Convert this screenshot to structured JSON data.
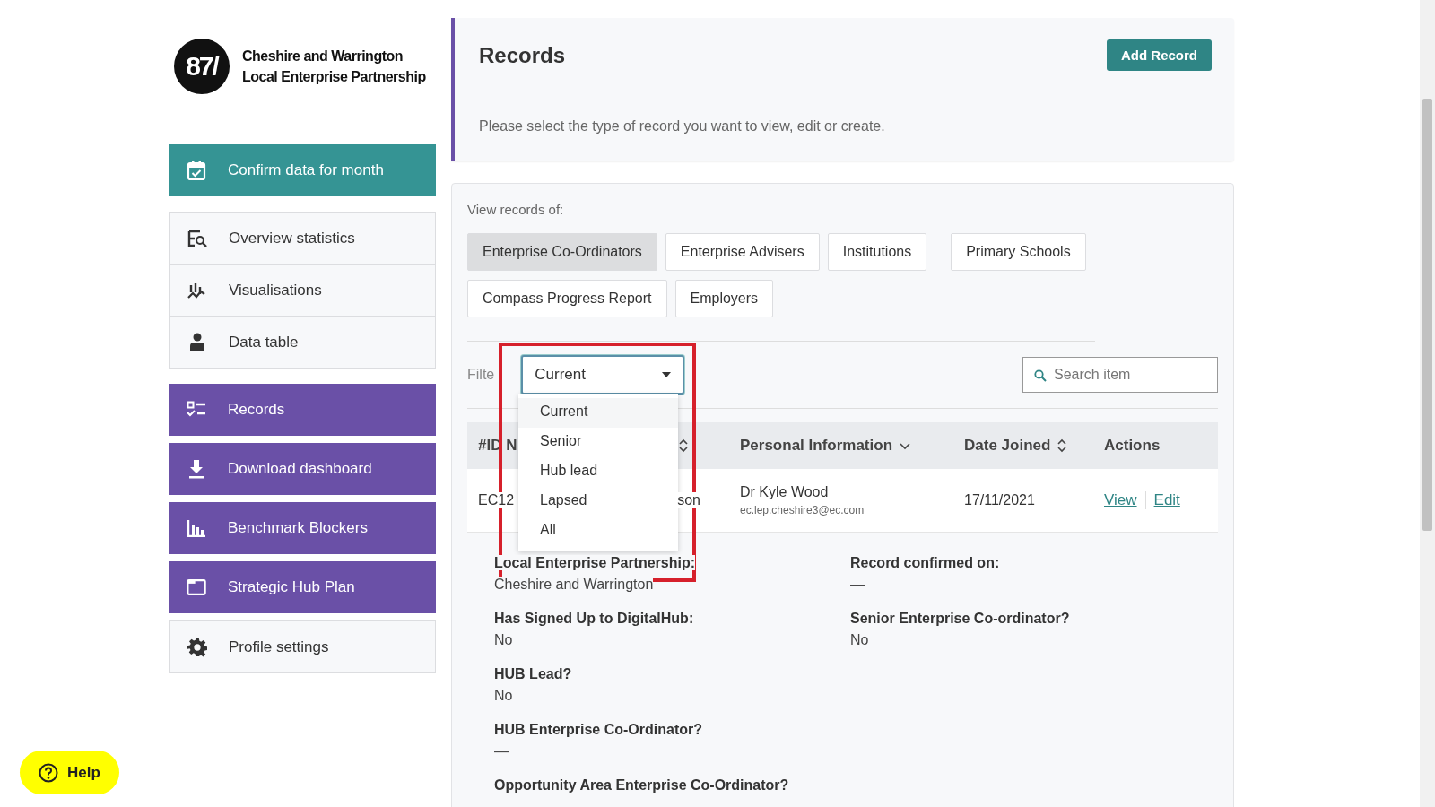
{
  "brand": {
    "logo_mark": "87/",
    "name_lines": [
      "Cheshire and Warrington",
      "Local Enterprise Partnership"
    ]
  },
  "sidebar": {
    "items": [
      {
        "label": "Confirm data for month",
        "kind": "highlight"
      },
      {
        "label": "Overview statistics",
        "kind": "plain"
      },
      {
        "label": "Visualisations",
        "kind": "plain"
      },
      {
        "label": "Data table",
        "kind": "plain"
      },
      {
        "label": "Records",
        "kind": "feature"
      },
      {
        "label": "Download dashboard",
        "kind": "feature"
      },
      {
        "label": "Benchmark Blockers",
        "kind": "feature"
      },
      {
        "label": "Strategic Hub Plan",
        "kind": "feature"
      },
      {
        "label": "Profile settings",
        "kind": "plain"
      }
    ]
  },
  "header": {
    "title": "Records",
    "add_button": "Add Record",
    "description": "Please select the type of record you want to view, edit or create."
  },
  "records_panel": {
    "label": "View records of:",
    "types": [
      {
        "label": "Enterprise Co-Ordinators",
        "selected": true
      },
      {
        "label": "Enterprise Advisers",
        "selected": false
      },
      {
        "label": "Institutions",
        "selected": false
      },
      {
        "label": "Primary Schools",
        "selected": false
      },
      {
        "label": "Compass Progress Report",
        "selected": false
      },
      {
        "label": "Employers",
        "selected": false
      }
    ],
    "filter": {
      "label": "Filte",
      "value": "Current",
      "expanded": true,
      "options": [
        {
          "label": "Current",
          "highlighted": true
        },
        {
          "label": "Senior",
          "highlighted": false
        },
        {
          "label": "Hub lead",
          "highlighted": false
        },
        {
          "label": "Lapsed",
          "highlighted": false
        },
        {
          "label": "All",
          "highlighted": false
        }
      ]
    },
    "search": {
      "placeholder": "Search item"
    },
    "table": {
      "columns": [
        {
          "label": "#ID N",
          "kind": "sortable"
        },
        {
          "label": "Personal Information",
          "kind": "menu"
        },
        {
          "label": "Date Joined",
          "kind": "sortable"
        },
        {
          "label": "Actions",
          "kind": "plain"
        }
      ],
      "rows": [
        {
          "id": "EC12",
          "name_fragment": "son",
          "person": "Dr Kyle Wood",
          "email": "ec.lep.cheshire3@ec.com",
          "date_joined": "17/11/2021",
          "actions": [
            "View",
            "Edit"
          ]
        }
      ]
    },
    "details": [
      [
        {
          "label": "Local Enterprise Partnership:",
          "value": "Cheshire and Warrington"
        },
        {
          "label": "Record confirmed on:",
          "value": "—"
        }
      ],
      [
        {
          "label": "Has Signed Up to DigitalHub:",
          "value": "No"
        },
        {
          "label": "Senior Enterprise Co-ordinator?",
          "value": "No"
        }
      ],
      [
        {
          "label": "HUB Lead?",
          "value": "No"
        }
      ],
      [
        {
          "label": "HUB Enterprise Co-Ordinator?",
          "value": "—"
        }
      ],
      [
        {
          "label": "Opportunity Area Enterprise Co-Ordinator?"
        }
      ]
    ]
  },
  "help": {
    "label": "Help"
  }
}
